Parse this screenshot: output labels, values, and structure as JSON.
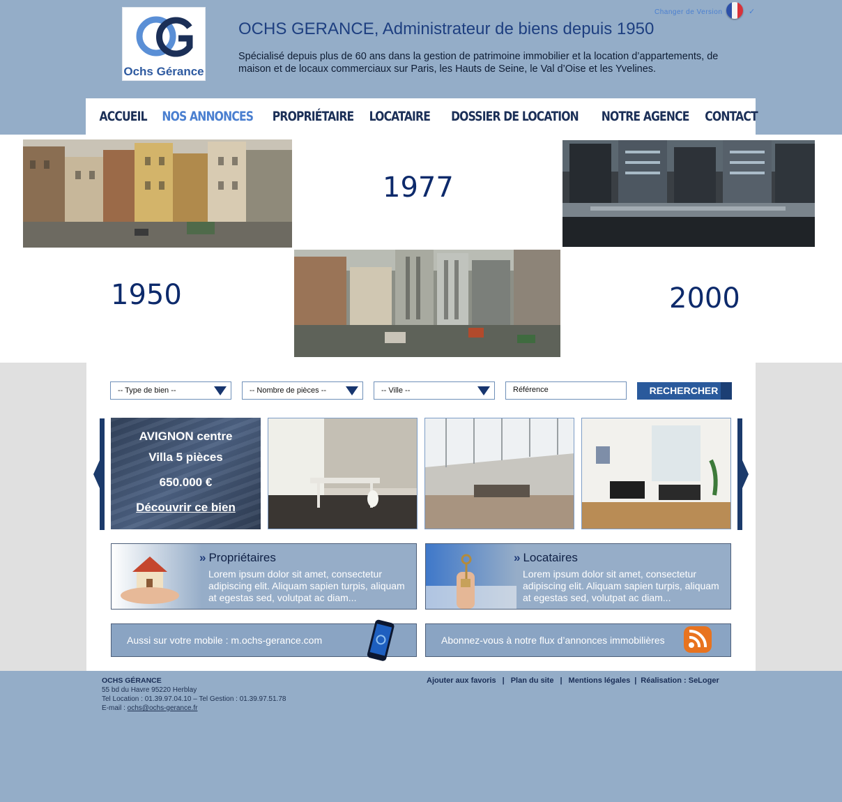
{
  "header": {
    "logo_text": "Ochs Gérance",
    "title": "OCHS GERANCE, Administrateur de biens depuis 1950",
    "description": "Spécialisé depuis plus de 60 ans dans la gestion de patrimoine immobilier et la location d’appartements, de maison et de locaux commerciaux sur Paris, les Hauts de Seine, le Val d’Oise et les Yvelines.",
    "lang_label": "Changer de Version"
  },
  "nav": {
    "items": [
      "ACCUEIL",
      "NOS ANNONCES",
      "PROPRIÉTAIRE",
      "LOCATAIRE",
      "DOSSIER DE LOCATION",
      "NOTRE AGENCE",
      "CONTACT"
    ],
    "active_index": 1
  },
  "banner": {
    "years": [
      "1977",
      "1950",
      "2000"
    ]
  },
  "search": {
    "type_bien": "-- Type de bien --",
    "nb_pieces": "-- Nombre de pièces --",
    "ville": "-- Ville --",
    "reference_placeholder": "Référence",
    "button": "RECHERCHER"
  },
  "featured": {
    "city": "AVIGNON centre",
    "type": "Villa 5 pièces",
    "price": "650.000 €",
    "link": "Découvrir ce bien"
  },
  "info_boxes": [
    {
      "title": "Propriétaires",
      "body": "Lorem ipsum dolor sit amet, consectetur adipiscing elit. Aliquam sapien turpis, aliquam at egestas sed, volutpat ac diam..."
    },
    {
      "title": "Locataires",
      "body": "Lorem ipsum dolor sit amet, consectetur adipiscing elit. Aliquam sapien turpis, aliquam at egestas sed, volutpat ac diam..."
    }
  ],
  "promos": {
    "mobile": "Aussi sur votre mobile : m.ochs-gerance.com",
    "rss": "Abonnez-vous à notre flux d’annonces immobilières"
  },
  "footer": {
    "name": "OCHS GÉRANCE",
    "address": "55 bd du Havre 95220 Herblay",
    "phones": "Tel Location : 01.39.97.04.10 – Tel Gestion : 01.39.97.51.78",
    "email_label": "E-mail : ",
    "email": "ochs@ochs-gerance.fr ",
    "links": [
      "Ajouter aux favoris",
      "Plan du site",
      "Mentions légales",
      "Réalisation : SeLoger"
    ],
    "separator": "|"
  },
  "colors": {
    "page_bg": "#94adc8",
    "nav_text": "#1b2f57",
    "nav_active": "#4a7fd0",
    "year_text": "#0d2a6b",
    "button": "#2a5a9c"
  },
  "icons": [
    "france-flag-icon",
    "chevron-down-icon",
    "dropdown-arrow-icon",
    "carousel-prev-icon",
    "carousel-next-icon",
    "chevron-right-icon",
    "smartphone-icon",
    "rss-icon"
  ]
}
